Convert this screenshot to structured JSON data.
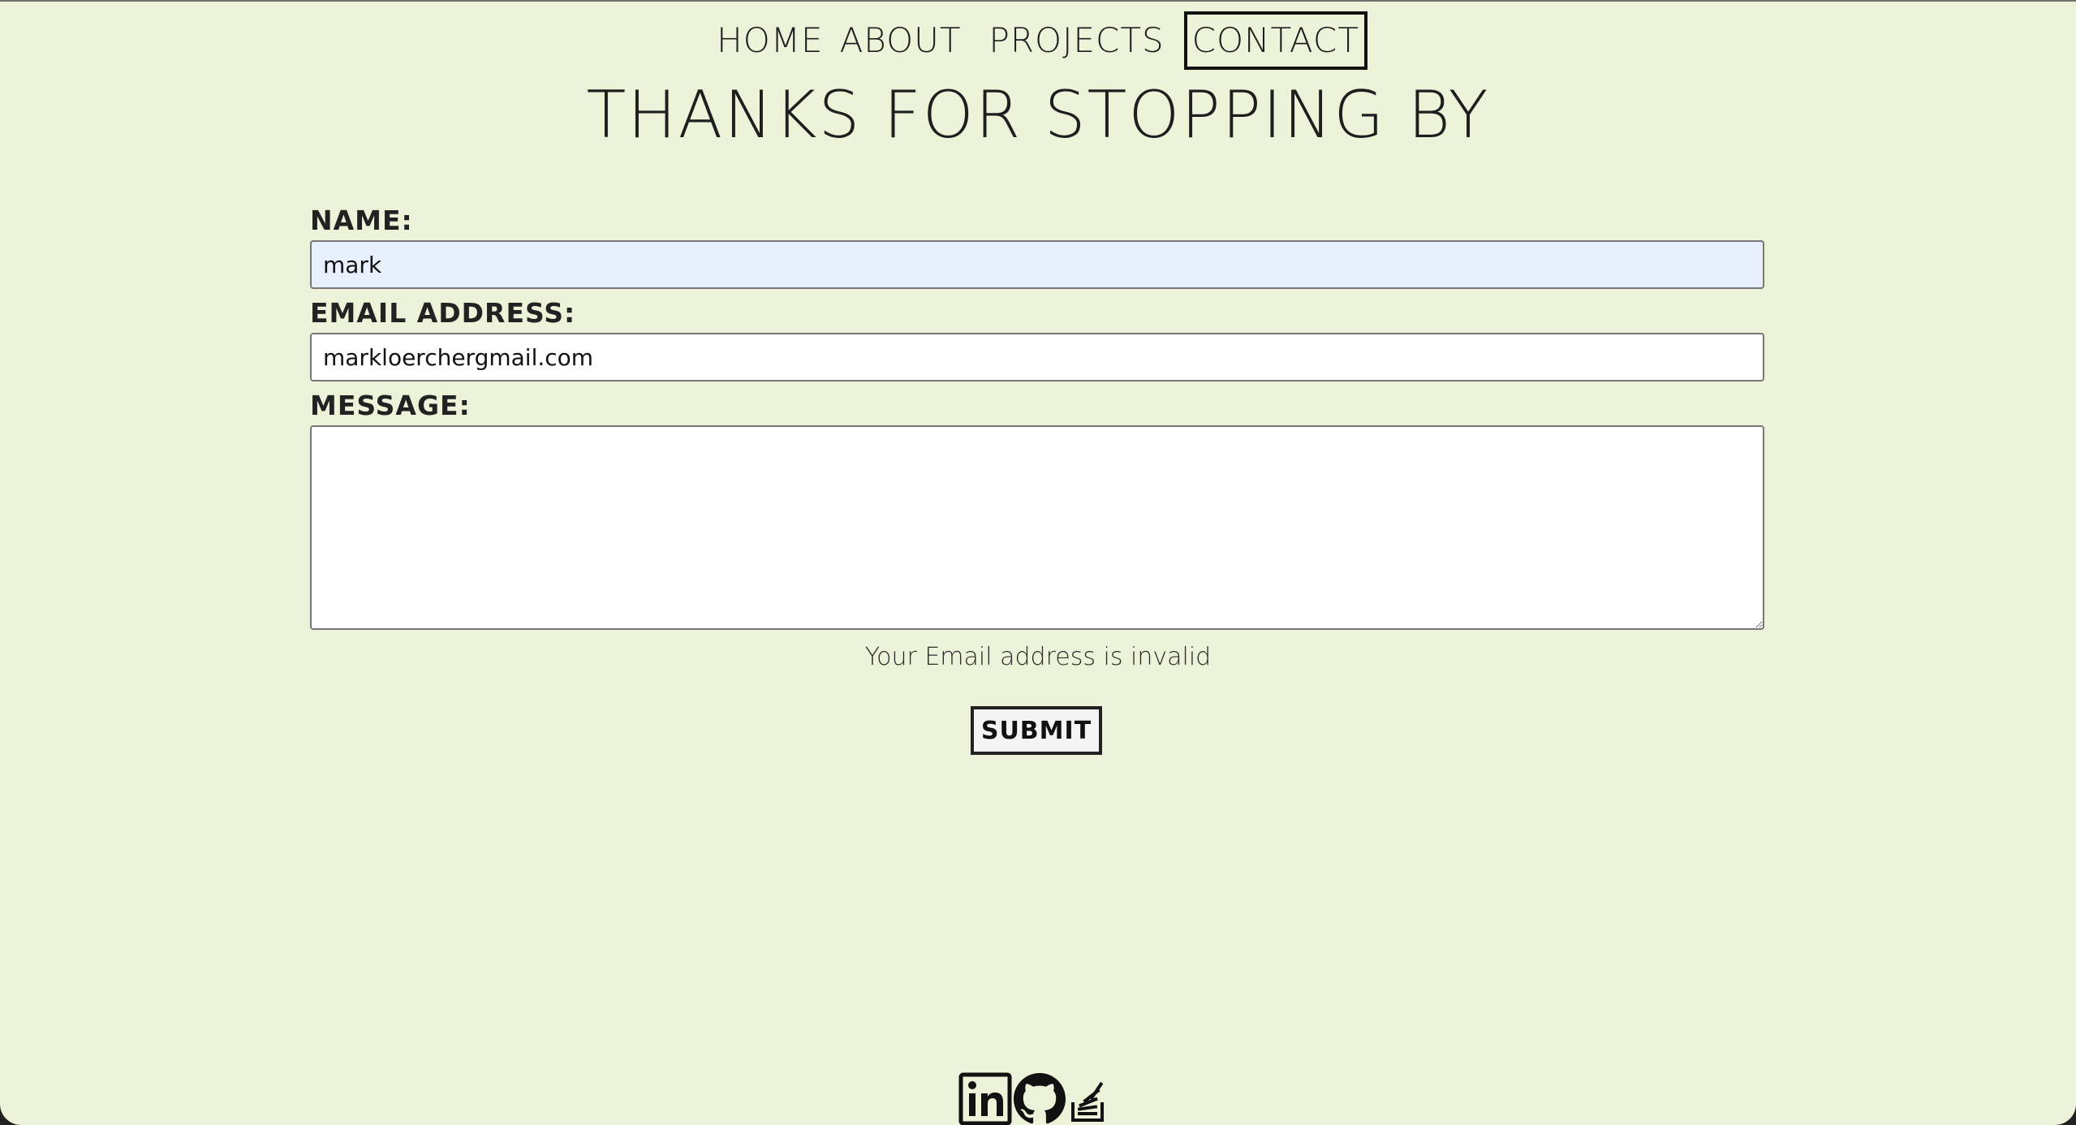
{
  "nav": {
    "home": "HOME",
    "about": "ABOUT",
    "projects": "PROJECTS",
    "contact": "CONTACT"
  },
  "hero": {
    "title": "THANKS FOR STOPPING BY"
  },
  "form": {
    "name_label": "NAME:",
    "name_value": "mark",
    "email_label": "EMAIL ADDRESS:",
    "email_value": "markloerchergmail.com",
    "message_label": "MESSAGE:",
    "message_value": "",
    "error": "Your Email address is invalid",
    "submit": "SUBMIT"
  },
  "socials": {
    "icons": [
      "linkedin-icon",
      "github-icon",
      "stackoverflow-icon"
    ]
  },
  "colors": {
    "background": "#edf3d8",
    "autofill": "#e8f0fe",
    "text": "#1e1e1e"
  }
}
